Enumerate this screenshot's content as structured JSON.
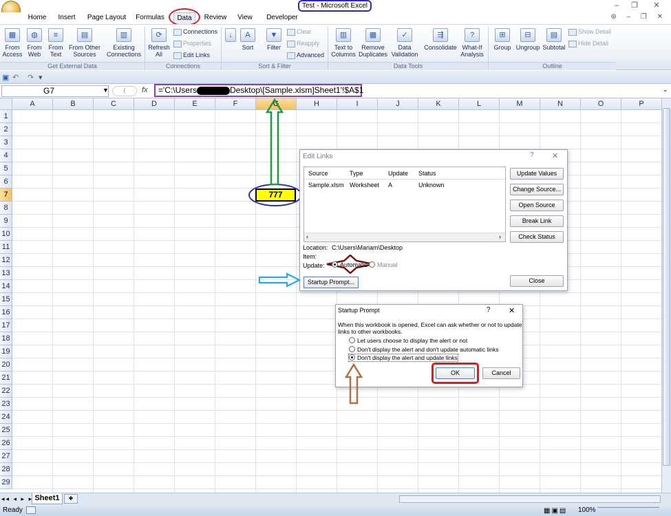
{
  "window": {
    "title": "Test - Microsoft Excel"
  },
  "tabs": [
    "Home",
    "Insert",
    "Page Layout",
    "Formulas",
    "Data",
    "Review",
    "View",
    "Developer"
  ],
  "ribbon": {
    "get_external": {
      "label": "Get External Data",
      "buttons": [
        "From Access",
        "From Web",
        "From Text",
        "From Other Sources"
      ],
      "existing": "Existing Connections"
    },
    "connections": {
      "label": "Connections",
      "refresh": "Refresh All",
      "connections": "Connections",
      "properties": "Properties",
      "edit_links": "Edit Links"
    },
    "sort_filter": {
      "label": "Sort & Filter",
      "sort": "Sort",
      "filter": "Filter",
      "clear": "Clear",
      "reapply": "Reapply",
      "advanced": "Advanced"
    },
    "data_tools": {
      "label": "Data Tools",
      "text_to_columns": "Text to Columns",
      "remove_duplicates": "Remove Duplicates",
      "data_validation": "Data Validation",
      "consolidate": "Consolidate",
      "what_if": "What-If Analysis"
    },
    "outline": {
      "label": "Outline",
      "group": "Group",
      "ungroup": "Ungroup",
      "subtotal": "Subtotal",
      "show_detail": "Show Detail",
      "hide_detail": "Hide Detail"
    }
  },
  "formula_bar": {
    "name_box": "G7",
    "fx": "fx",
    "formula_prefix": "='C:\\Users",
    "formula_suffix": "Desktop\\[Sample.xlsm]Sheet1'!$A$1"
  },
  "grid": {
    "columns": [
      "A",
      "B",
      "C",
      "D",
      "E",
      "F",
      "G",
      "H",
      "I",
      "J",
      "K",
      "L",
      "M",
      "N",
      "O",
      "P"
    ],
    "rows": [
      "1",
      "2",
      "3",
      "4",
      "5",
      "6",
      "7",
      "8",
      "9",
      "10",
      "11",
      "12",
      "13",
      "14",
      "15",
      "16",
      "17",
      "18",
      "19",
      "20",
      "21",
      "22",
      "23",
      "24",
      "25",
      "26",
      "27",
      "28",
      "29"
    ],
    "g7_value": "777"
  },
  "edit_links": {
    "title": "Edit Links",
    "help": "?",
    "close_x": "✕",
    "headers": [
      "Source",
      "Type",
      "Update",
      "Status"
    ],
    "row": [
      "Sample.xlsm",
      "Worksheet",
      "A",
      "Unknown"
    ],
    "buttons": [
      "Update Values",
      "Change Source...",
      "Open Source",
      "Break Link",
      "Check Status"
    ],
    "location_label": "Location:",
    "location_value": "C:\\Users\\Mariam\\Desktop",
    "item_label": "Item:",
    "update_label": "Update:",
    "automatic": "Automatic",
    "manual": "Manual",
    "startup_button": "Startup Prompt...",
    "close_button": "Close"
  },
  "startup_prompt": {
    "title": "Startup Prompt",
    "help": "?",
    "close_x": "✕",
    "description": "When this workbook is opened, Excel can ask whether or not to update links to other workbooks.",
    "options": [
      "Let users choose to display the alert or not",
      "Don't display the alert and don't update automatic links",
      "Don't display the alert and update links"
    ],
    "ok": "OK",
    "cancel": "Cancel"
  },
  "sheet_tabs": {
    "active": "Sheet1"
  },
  "status": {
    "ready": "Ready",
    "zoom": "100%"
  },
  "colors": {
    "accent_red": "#d42020",
    "accent_blue": "#2b2bb8",
    "purple": "#9040a0",
    "green": "#1f9a40",
    "cyan": "#27a8e0",
    "brown": "#b07040",
    "maroon": "#7a1010"
  }
}
